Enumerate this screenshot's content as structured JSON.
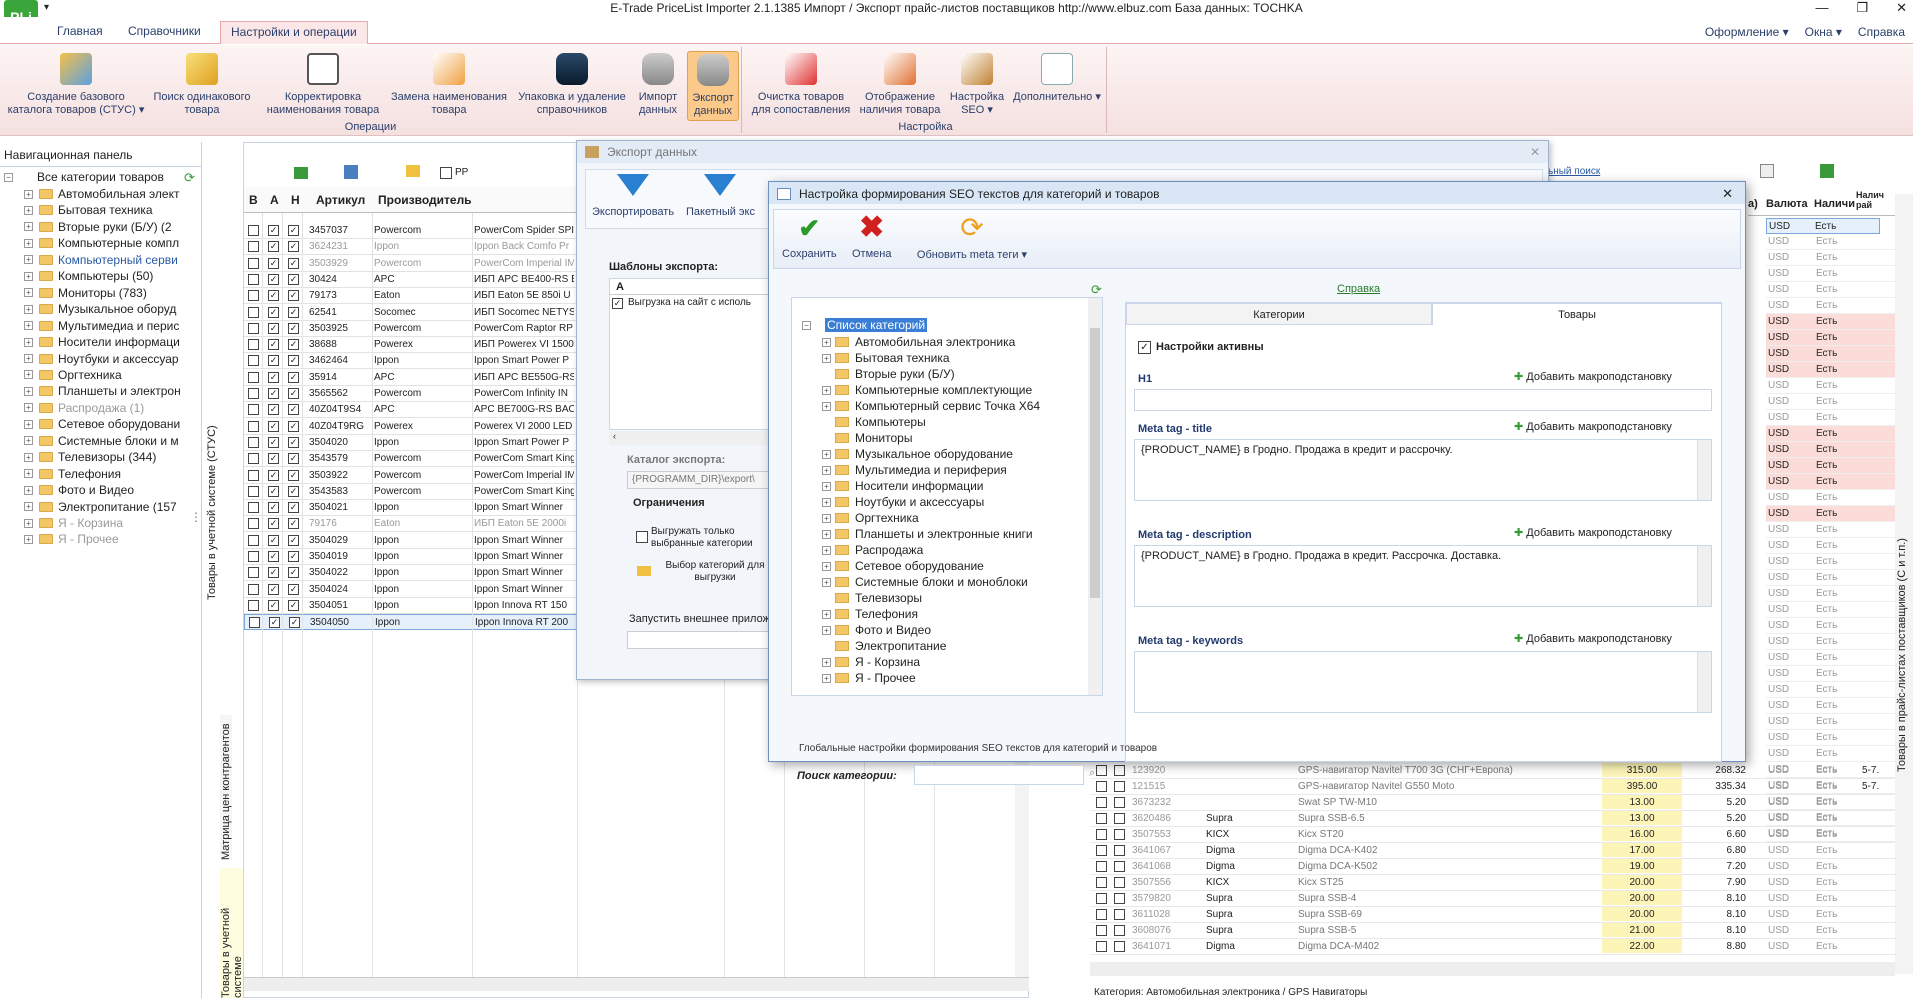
{
  "app": {
    "logo": "PLi",
    "title": "E-Trade PriceList Importer 2.1.1385   Импорт / Экспорт прайс-листов поставщиков   http://www.elbuz.com   База данных: TOCHKA"
  },
  "menu": {
    "tabs": [
      "Главная",
      "Справочники",
      "Настройки и операции"
    ],
    "right": [
      "Оформление ▾",
      "Окна ▾",
      "Справка"
    ]
  },
  "ribbon": {
    "operations": {
      "label": "Операции",
      "buttons": [
        "Создание базового каталога товаров (СТУС) ▾",
        "Поиск одинакового товара",
        "Корректировка наименования товара",
        "Замена наименования товара",
        "Упаковка и удаление справочников",
        "Импорт данных",
        "Экспорт данных"
      ]
    },
    "settings": {
      "label": "Настройка",
      "buttons": [
        "Очистка товаров для сопоставления",
        "Отображение наличия товара",
        "Настройка SEO ▾",
        "Дополнительно ▾"
      ]
    }
  },
  "nav": {
    "header": "Навигационная панель",
    "root": "Все категории товаров",
    "items": [
      {
        "label": "Автомобильная элект",
        "style": ""
      },
      {
        "label": "Бытовая техника",
        "style": ""
      },
      {
        "label": "Вторые руки (Б/У) (2",
        "style": ""
      },
      {
        "label": "Компьютерные компл",
        "style": ""
      },
      {
        "label": "Компьютерный серви",
        "style": "blue"
      },
      {
        "label": "Компьютеры (50)",
        "style": ""
      },
      {
        "label": "Мониторы (783)",
        "style": ""
      },
      {
        "label": "Музыкальное оборуд",
        "style": ""
      },
      {
        "label": "Мультимедиа и перис",
        "style": ""
      },
      {
        "label": "Носители информаци",
        "style": ""
      },
      {
        "label": "Ноутбуки и аксессуар",
        "style": ""
      },
      {
        "label": "Оргтехника",
        "style": ""
      },
      {
        "label": "Планшеты и электрон",
        "style": ""
      },
      {
        "label": "Распродажа (1)",
        "style": "gray"
      },
      {
        "label": "Сетевое оборудовани",
        "style": ""
      },
      {
        "label": "Системные блоки и м",
        "style": ""
      },
      {
        "label": "Телевизоры (344)",
        "style": ""
      },
      {
        "label": "Телефония",
        "style": ""
      },
      {
        "label": "Фото и Видео",
        "style": ""
      },
      {
        "label": "Электропитание (157",
        "style": ""
      },
      {
        "label": "Я - Корзина",
        "style": "gray"
      },
      {
        "label": "Я - Прочее",
        "style": "gray"
      }
    ],
    "vtabs": [
      "Товары в учетной системе (СТУС)",
      "Матрица цен контрагентов",
      "Товары в учетной системе"
    ]
  },
  "leftgrid": {
    "toolbar_checkbox": "PP",
    "headers": [
      "В",
      "А",
      "Н",
      "Артикул",
      "Производитель"
    ],
    "rows": [
      {
        "art": "3457037",
        "maker": "Powercom",
        "name": "PowerCom Spider SPI",
        "gray": false
      },
      {
        "art": "3624231",
        "maker": "Ippon",
        "name": "Ippon Back Comfo Pr",
        "gray": true
      },
      {
        "art": "3503929",
        "maker": "Powercom",
        "name": "PowerCom Imperial IM",
        "gray": true
      },
      {
        "art": "30424",
        "maker": "APC",
        "name": "ИБП APC BE400-RS B",
        "gray": false
      },
      {
        "art": "79173",
        "maker": "Eaton",
        "name": "ИБП Eaton 5E 850i U",
        "gray": false
      },
      {
        "art": "62541",
        "maker": "Socomec",
        "name": "ИБП Socomec NETYS",
        "gray": false
      },
      {
        "art": "3503925",
        "maker": "Powercom",
        "name": "PowerCom Raptor RP",
        "gray": false
      },
      {
        "art": "38688",
        "maker": "Powerex",
        "name": "ИБП Powerex VI 1500",
        "gray": false
      },
      {
        "art": "3462464",
        "maker": "Ippon",
        "name": "Ippon Smart Power P",
        "gray": false
      },
      {
        "art": "35914",
        "maker": "APC",
        "name": "ИБП APC BE550G-RS",
        "gray": false
      },
      {
        "art": "3565562",
        "maker": "Powercom",
        "name": "PowerCom Infinity IN",
        "gray": false
      },
      {
        "art": "40Z04T9S4",
        "maker": "APC",
        "name": "APC BE700G-RS BAC",
        "gray": false
      },
      {
        "art": "40Z04T9RG",
        "maker": "Powerex",
        "name": "Powerex VI 2000 LED",
        "gray": false
      },
      {
        "art": "3504020",
        "maker": "Ippon",
        "name": "Ippon Smart Power P",
        "gray": false
      },
      {
        "art": "3543579",
        "maker": "Powercom",
        "name": "PowerCom Smart King",
        "gray": false
      },
      {
        "art": "3503922",
        "maker": "Powercom",
        "name": "PowerCom Imperial IM",
        "gray": false
      },
      {
        "art": "3543583",
        "maker": "Powercom",
        "name": "PowerCom Smart King",
        "gray": false
      },
      {
        "art": "3504021",
        "maker": "Ippon",
        "name": "Ippon Smart Winner",
        "gray": false
      },
      {
        "art": "79176",
        "maker": "Eaton",
        "name": "ИБП Eaton 5E 2000i",
        "gray": true
      },
      {
        "art": "3504029",
        "maker": "Ippon",
        "name": "Ippon Smart Winner",
        "gray": false
      },
      {
        "art": "3504019",
        "maker": "Ippon",
        "name": "Ippon Smart Winner",
        "gray": false
      },
      {
        "art": "3504022",
        "maker": "Ippon",
        "name": "Ippon Smart Winner",
        "gray": false
      },
      {
        "art": "3504024",
        "maker": "Ippon",
        "name": "Ippon Smart Winner",
        "gray": false
      },
      {
        "art": "3504051",
        "maker": "Ippon",
        "name": "Ippon Innova RT 150",
        "gray": false
      },
      {
        "art": "3504050",
        "maker": "Ippon",
        "name": "Ippon Innova RT 200",
        "gray": false
      }
    ]
  },
  "rightgrid": {
    "link": "ьный поиск",
    "headers": [
      "а)",
      "Валюта",
      "Наличи",
      "Налич рай"
    ],
    "top_rows": [
      {
        "cur": "USD",
        "avail": "Есть",
        "extra": ""
      }
    ],
    "side_label": "Товары в прайс-листах поставщиков (С и т.п.)",
    "rows": [
      {
        "art": "123920",
        "maker": "",
        "name": "GPS-навигатор Navitel T700 3G (СНГ+Европа)",
        "p1": "315.00",
        "p2": "268.32",
        "cur": "USD",
        "avail": "Есть",
        "extra": "5-7."
      },
      {
        "art": "121515",
        "maker": "",
        "name": "GPS-навигатор Navitel G550 Moto",
        "p1": "395.00",
        "p2": "335.34",
        "cur": "USD",
        "avail": "Есть",
        "extra": "5-7."
      },
      {
        "art": "3673232",
        "maker": "",
        "name": "Swat SP TW-M10",
        "p1": "13.00",
        "p2": "5.20",
        "cur": "USD",
        "avail": "Есть",
        "extra": ""
      },
      {
        "art": "3620486",
        "maker": "Supra",
        "name": "Supra SSB-6.5",
        "p1": "13.00",
        "p2": "5.20",
        "cur": "USD",
        "avail": "Есть",
        "extra": ""
      },
      {
        "art": "3507553",
        "maker": "KICX",
        "name": "Kicx ST20",
        "p1": "16.00",
        "p2": "6.60",
        "cur": "USD",
        "avail": "Есть",
        "extra": ""
      },
      {
        "art": "3641067",
        "maker": "Digma",
        "name": "Digma DCA-K402",
        "p1": "17.00",
        "p2": "6.80",
        "cur": "USD",
        "avail": "Есть",
        "extra": ""
      },
      {
        "art": "3641068",
        "maker": "Digma",
        "name": "Digma DCA-K502",
        "p1": "19.00",
        "p2": "7.20",
        "cur": "USD",
        "avail": "Есть",
        "extra": ""
      },
      {
        "art": "3507556",
        "maker": "KICX",
        "name": "Kicx ST25",
        "p1": "20.00",
        "p2": "7.90",
        "cur": "USD",
        "avail": "Есть",
        "extra": ""
      },
      {
        "art": "3579820",
        "maker": "Supra",
        "name": "Supra SSB-4",
        "p1": "20.00",
        "p2": "8.10",
        "cur": "USD",
        "avail": "Есть",
        "extra": ""
      },
      {
        "art": "3611028",
        "maker": "Supra",
        "name": "Supra SSB-69",
        "p1": "20.00",
        "p2": "8.10",
        "cur": "USD",
        "avail": "Есть",
        "extra": ""
      },
      {
        "art": "3608076",
        "maker": "Supra",
        "name": "Supra SSB-5",
        "p1": "21.00",
        "p2": "8.10",
        "cur": "USD",
        "avail": "Есть",
        "extra": ""
      },
      {
        "art": "3641071",
        "maker": "Digma",
        "name": "Digma DCA-M402",
        "p1": "22.00",
        "p2": "8.80",
        "cur": "USD",
        "avail": "Есть",
        "extra": ""
      }
    ],
    "status": "Категория: Автомобильная электроника / GPS Навигаторы"
  },
  "exportdlg": {
    "title": "Экспорт данных",
    "btn_export": "Экспортировать",
    "btn_batch": "Пакетный экс",
    "templates_label": "Шаблоны экспорта:",
    "col_a": "A",
    "template_item": "Выгрузка на сайт с исполь",
    "catalog_label": "Каталог экспорта:",
    "catalog_value": "{PROGRAMM_DIR}\\export\\",
    "limits_label": "Ограничения",
    "limit_only_selected": "Выгружать только выбранные категории",
    "limit_choose": "Выбор категорий для выгрузки",
    "run_external": "Запустить внешнее прилож"
  },
  "seodlg": {
    "title": "Настройка формирования SEO текстов для категорий и товаров",
    "buttons": [
      "Сохранить",
      "Отмена",
      "Обновить meta теги ▾"
    ],
    "help_link": "Справка",
    "tree_root": "Список категорий",
    "tree": [
      {
        "label": "Автомобильная электроника",
        "plus": true
      },
      {
        "label": "Бытовая техника",
        "plus": true
      },
      {
        "label": "Вторые руки (Б/У)",
        "plus": false
      },
      {
        "label": "Компьютерные комплектующие",
        "plus": true
      },
      {
        "label": "Компьютерный сервис Точка X64",
        "plus": true
      },
      {
        "label": "Компьютеры",
        "plus": false
      },
      {
        "label": "Мониторы",
        "plus": false
      },
      {
        "label": "Музыкальное оборудование",
        "plus": true
      },
      {
        "label": "Мультимедиа и периферия",
        "plus": true
      },
      {
        "label": "Носители информации",
        "plus": true
      },
      {
        "label": "Ноутбуки и аксессуары",
        "plus": true
      },
      {
        "label": "Оргтехника",
        "plus": true
      },
      {
        "label": "Планшеты и электронные книги",
        "plus": true
      },
      {
        "label": "Распродажа",
        "plus": true
      },
      {
        "label": "Сетевое оборудование",
        "plus": true
      },
      {
        "label": "Системные блоки и моноблоки",
        "plus": true
      },
      {
        "label": "Телевизоры",
        "plus": false
      },
      {
        "label": "Телефония",
        "plus": true
      },
      {
        "label": "Фото и Видео",
        "plus": true
      },
      {
        "label": "Электропитание",
        "plus": false
      },
      {
        "label": "Я - Корзина",
        "plus": true
      },
      {
        "label": "Я - Прочее",
        "plus": true
      }
    ],
    "search_label": "Поиск категории:",
    "tabs": [
      "Категории",
      "Товары"
    ],
    "active_checkbox": "Настройки активны",
    "add_macro": "Добавить макроподстановку",
    "fields": [
      {
        "label": "H1",
        "value": ""
      },
      {
        "label": "Meta tag - title",
        "value": "{PRODUCT_NAME} в Гродно. Продажа в кредит и рассрочку."
      },
      {
        "label": "Meta tag - description",
        "value": "{PRODUCT_NAME} в Гродно. Продажа в кредит. Рассрочка. Доставка."
      },
      {
        "label": "Meta tag - keywords",
        "value": ""
      }
    ],
    "status": "Глобальные настройки формирования SEO текстов для категорий и товаров"
  }
}
